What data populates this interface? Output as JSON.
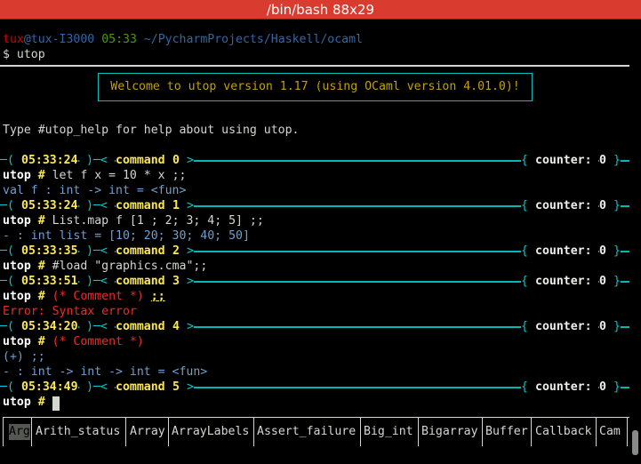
{
  "window": {
    "title": "/bin/bash 88x29"
  },
  "shell": {
    "user": "tux",
    "at_host": "@tux-I3000",
    "time": "05:33",
    "path": "~/PycharmProjects/Haskell/ocaml",
    "command": "$ utop"
  },
  "welcome": "Welcome to utop version 1.17 (using OCaml version 4.01.0)!",
  "help_text": "Type #utop_help for help about using utop.",
  "bar_labels": {
    "open": "─( ",
    "close": " )─< ",
    "cmd": "command ",
    "end_gt": " >",
    "counter_open": "{ ",
    "counter": "counter: ",
    "counter_close": " }"
  },
  "prompt": "utop",
  "prompt_hash": " # ",
  "sessions": [
    {
      "time": "05:33:24",
      "command": "0",
      "counter": "0",
      "input": "let f x = 10 * x ;;",
      "output": "val f : int -> int = <fun>"
    },
    {
      "time": "05:33:24",
      "command": "1",
      "counter": "0",
      "input": "List.map f [1 ; 2; 3; 4; 5] ;;",
      "output": "- : int list = [10; 20; 30; 40; 50]"
    },
    {
      "time": "05:33:35",
      "command": "2",
      "counter": "0",
      "input": "#load \"graphics.cma\";;"
    },
    {
      "time": "05:33:51",
      "command": "3",
      "counter": "0",
      "input_comment": "(* Comment *)",
      "input_tail": ";;",
      "error": "Error: Syntax error"
    },
    {
      "time": "05:34:20",
      "command": "4",
      "counter": "0",
      "input_comment": "(* Comment *)",
      "continuation": "(+) ;;",
      "output": "- : int -> int -> int = <fun>"
    },
    {
      "time": "05:34:49",
      "command": "5",
      "counter": "0"
    }
  ],
  "completions": [
    "Arg",
    "Arith_status",
    "Array",
    "ArrayLabels",
    "Assert_failure",
    "Big_int",
    "Bigarray",
    "Buffer",
    "Callback",
    "Cam"
  ],
  "colors": {
    "titlebar": "#d93b2f",
    "bar": "#06b6b6",
    "error": "#ef2929",
    "accent": "#fce94f"
  }
}
